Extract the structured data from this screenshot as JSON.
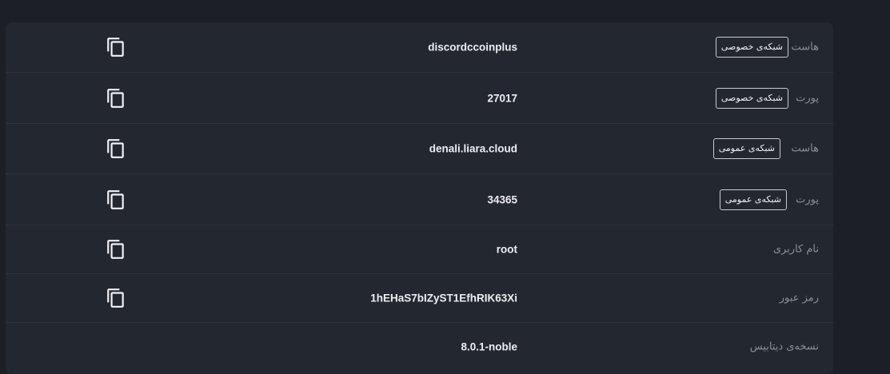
{
  "rows": [
    {
      "label": "هاست",
      "badge": "شبکه‌ی خصوصی",
      "value": "discordccoinplus",
      "copy": true
    },
    {
      "label": "پورت",
      "badge": "شبکه‌ی خصوصی",
      "value": "27017",
      "copy": true
    },
    {
      "label": "هاست",
      "badge": "شبکه‌ی عمومی",
      "value": "denali.liara.cloud",
      "copy": true
    },
    {
      "label": "پورت",
      "badge": "شبکه‌ی عمومی",
      "value": "34365",
      "copy": true
    },
    {
      "label": "نام کاربری",
      "badge": "",
      "value": "root",
      "copy": true
    },
    {
      "label": "رمز عبور",
      "badge": "",
      "value": "1hEHaS7bIZyST1EfhRIK63Xi",
      "copy": true
    },
    {
      "label": "نسخه‌ی دیتابیس",
      "badge": "",
      "value": "8.0.1-noble",
      "copy": false
    }
  ],
  "icons": {
    "copy": "copy-icon"
  },
  "colors": {
    "background": "#1c1f26",
    "card": "#232730",
    "label": "#8a8f99",
    "value": "#eceef1"
  }
}
